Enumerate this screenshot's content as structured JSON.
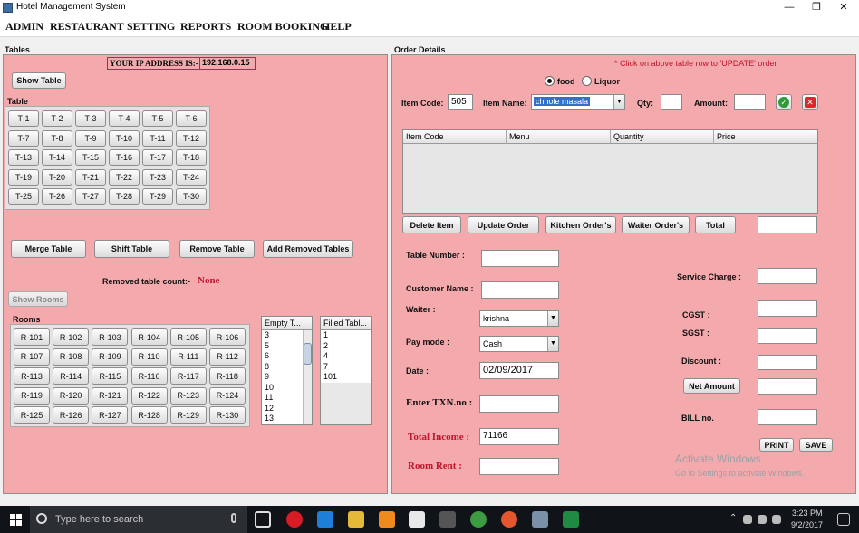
{
  "window": {
    "title": "Hotel Management System",
    "minimize": "—",
    "maximize": "❐",
    "close": "✕"
  },
  "menu": [
    "ADMIN",
    "RESTAURANT",
    "SETTING",
    "REPORTS",
    "ROOM BOOKING",
    "HELP"
  ],
  "tables_panel": {
    "group_label": "Tables",
    "ip_label": "YOUR IP ADDRESS IS:-",
    "ip_value": "192.168.0.15",
    "show_table": "Show Table",
    "table_box_label": "Table",
    "tables": [
      "T-1",
      "T-2",
      "T-3",
      "T-4",
      "T-5",
      "T-6",
      "T-7",
      "T-8",
      "T-9",
      "T-10",
      "T-11",
      "T-12",
      "T-13",
      "T-14",
      "T-15",
      "T-16",
      "T-17",
      "T-18",
      "T-19",
      "T-20",
      "T-21",
      "T-22",
      "T-23",
      "T-24",
      "T-25",
      "T-26",
      "T-27",
      "T-28",
      "T-29",
      "T-30"
    ],
    "merge_table": "Merge Table",
    "shift_table": "Shift Table",
    "remove_table": "Remove Table",
    "add_removed_tables": "Add Removed Tables",
    "removed_count_label": "Removed table count:-",
    "removed_count_value": "None",
    "show_rooms": "Show Rooms",
    "rooms_box_label": "Rooms",
    "rooms": [
      "R-101",
      "R-102",
      "R-103",
      "R-104",
      "R-105",
      "R-106",
      "R-107",
      "R-108",
      "R-109",
      "R-110",
      "R-111",
      "R-112",
      "R-113",
      "R-114",
      "R-115",
      "R-116",
      "R-117",
      "R-118",
      "R-119",
      "R-120",
      "R-121",
      "R-122",
      "R-123",
      "R-124",
      "R-125",
      "R-126",
      "R-127",
      "R-128",
      "R-129",
      "R-130"
    ],
    "empty_tables_header": "Empty T...",
    "empty_tables": [
      "3",
      "5",
      "6",
      "8",
      "9",
      "10",
      "11",
      "12",
      "13"
    ],
    "filled_tables_header": "Filled Tabl...",
    "filled_tables": [
      "1",
      "2",
      "4",
      "7",
      "101"
    ]
  },
  "order_panel": {
    "group_label": "Order Details",
    "hint": "* Click on above table row to 'UPDATE' order",
    "radio_food": "food",
    "radio_liquor": "Liquor",
    "item_code_label": "Item Code:",
    "item_code_value": "505",
    "item_name_label": "Item Name:",
    "item_name_value": "chhole masala",
    "qty_label": "Qty:",
    "amount_label": "Amount:",
    "columns": [
      "Item Code",
      "Menu",
      "Quantity",
      "Price"
    ],
    "delete_item": "Delete Item",
    "update_order": "Update Order",
    "kitchen_orders": "Kitchen Order's",
    "waiter_orders": "Waiter Order's",
    "total": "Total",
    "table_number_label": "Table  Number :",
    "customer_name_label": "Customer Name :",
    "waiter_label": "Waiter :",
    "waiter_value": "krishna",
    "pay_mode_label": "Pay mode :",
    "pay_mode_value": "Cash",
    "date_label": "Date :",
    "date_value": "02/09/2017",
    "txn_label": "Enter TXN.no :",
    "total_income_label": "Total Income :",
    "total_income_value": "71166",
    "room_rent_label": "Room Rent :",
    "service_charge_label": "Service Charge  :",
    "cgst_label": "CGST :",
    "sgst_label": "SGST :",
    "discount_label": "Discount :",
    "net_amount": "Net Amount",
    "bill_no_label": "BILL no.",
    "print": "PRINT",
    "save": "SAVE"
  },
  "watermark": {
    "title": "Activate Windows",
    "sub": "Go to Settings to activate Windows."
  },
  "taskbar": {
    "search_placeholder": "Type here to search",
    "time": "3:23 PM",
    "date": "9/2/2017"
  },
  "colors": {
    "panel": "#f4aaad",
    "red_text": "#c0152b",
    "taskbar": "#101418"
  }
}
